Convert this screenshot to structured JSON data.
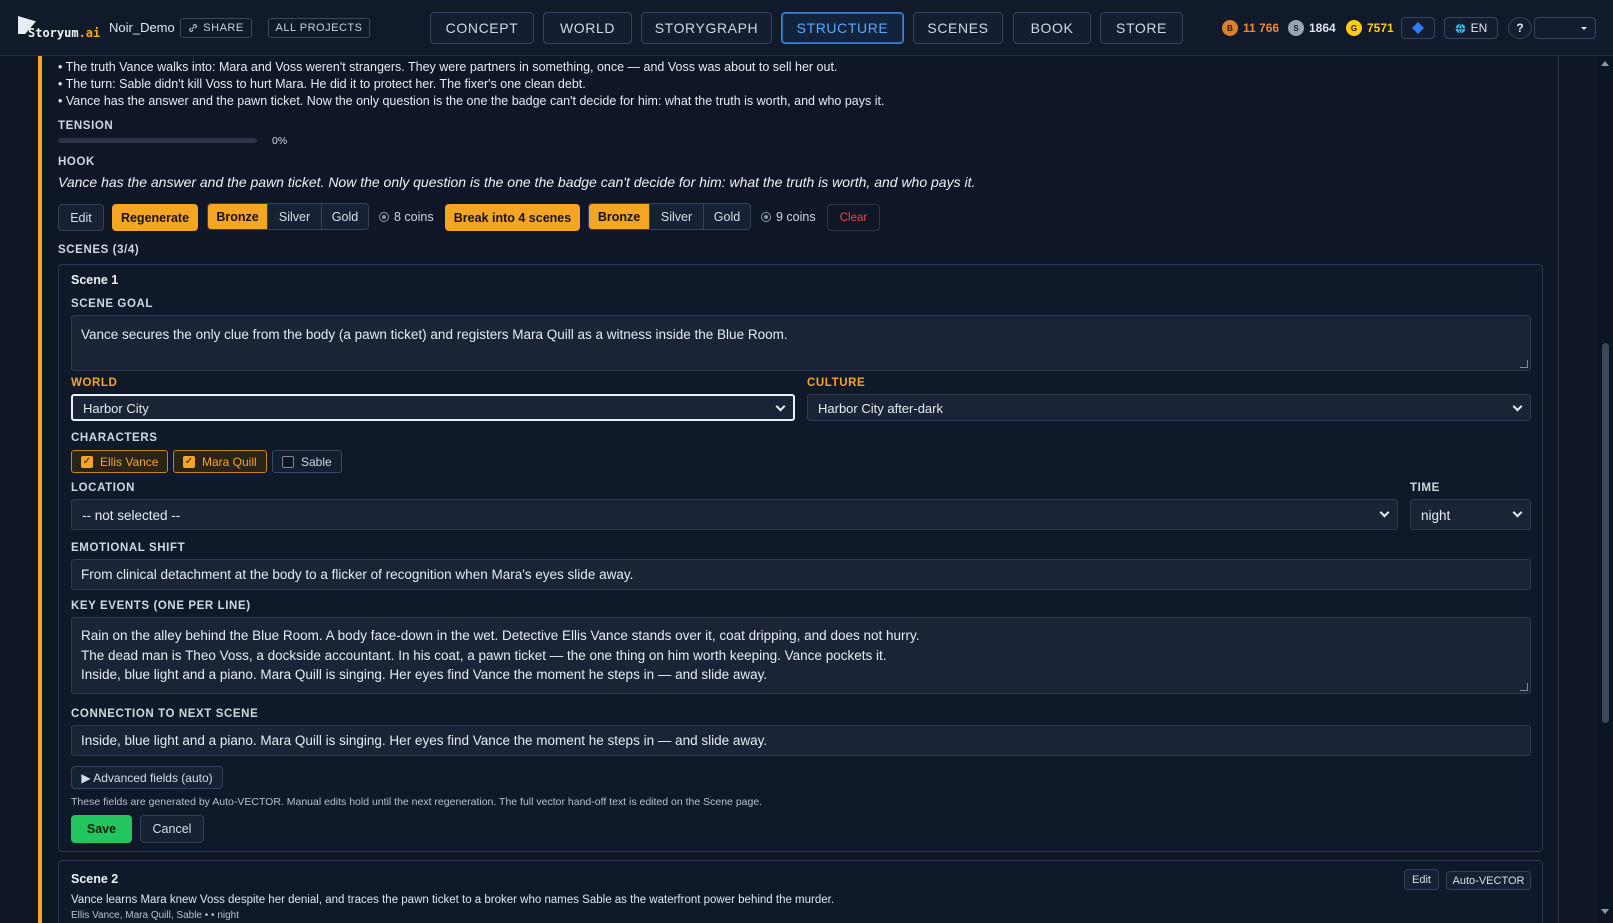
{
  "topbar": {
    "project_name": "Noir_Demo",
    "share_label": "SHARE",
    "all_projects_label": "ALL PROJECTS",
    "tabs": [
      {
        "label": "CONCEPT",
        "active": false
      },
      {
        "label": "WORLD",
        "active": false
      },
      {
        "label": "STORYGRAPH",
        "active": false
      },
      {
        "label": "STRUCTURE",
        "active": true
      },
      {
        "label": "SCENES",
        "active": false
      },
      {
        "label": "BOOK",
        "active": false
      },
      {
        "label": "STORE",
        "active": false
      }
    ],
    "currencies": [
      {
        "letter": "B",
        "value": "11 766",
        "color": "#d9822b"
      },
      {
        "letter": "S",
        "value": "1864",
        "color": "#9aa3b0"
      },
      {
        "letter": "G",
        "value": "7571",
        "color": "#facc15"
      }
    ],
    "diamond_icon": "diamond-icon",
    "language": "EN",
    "help_label": "?",
    "user_menu_value": ""
  },
  "logo": {
    "prefix": "Storyum",
    "suffix": ".ai"
  },
  "summary_bullets": [
    "• The truth Vance walks into: Mara and Voss weren't strangers. They were partners in something, once — and Voss was about to sell her out.",
    "• The turn: Sable didn't kill Voss to hurt Mara. He did it to protect her. The fixer's one clean debt.",
    "• Vance has the answer and the pawn ticket. Now the only question is the one the badge can't decide for him: what the truth is worth, and who pays it."
  ],
  "tension": {
    "label": "TENSION",
    "value_label": "0%",
    "value": 0
  },
  "hook": {
    "label": "HOOK",
    "text": "Vance has the answer and the pawn ticket. Now the only question is the one the badge can't decide for him: what the truth is worth, and who pays it."
  },
  "actions": {
    "edit": "Edit",
    "regenerate": "Regenerate",
    "tiers_1": [
      "Bronze",
      "Silver",
      "Gold"
    ],
    "cost_1": "8 coins",
    "break_into": "Break into 4 scenes",
    "tiers_2": [
      "Bronze",
      "Silver",
      "Gold"
    ],
    "cost_2": "9 coins",
    "clear": "Clear",
    "accent_color": "#f5a524"
  },
  "scenes_header": "SCENES (3/4)",
  "scene1": {
    "title": "Scene 1",
    "goal_label": "SCENE GOAL",
    "goal": "Vance secures the only clue from the body (a pawn ticket) and registers Mara Quill as a witness inside the Blue Room.",
    "world_label": "WORLD",
    "world": "Harbor City",
    "culture_label": "CULTURE",
    "culture": "Harbor City after-dark",
    "characters_label": "CHARACTERS",
    "characters": [
      {
        "name": "Ellis Vance",
        "checked": true
      },
      {
        "name": "Mara Quill",
        "checked": true
      },
      {
        "name": "Sable",
        "checked": false
      }
    ],
    "location_label": "LOCATION",
    "location": "-- not selected --",
    "time_label": "TIME",
    "time": "night",
    "emotional_label": "EMOTIONAL SHIFT",
    "emotional": "From clinical detachment at the body to a flicker of recognition when Mara's eyes slide away.",
    "key_events_label": "KEY EVENTS (ONE PER LINE)",
    "key_events": [
      "Rain on the alley behind the Blue Room. A body face-down in the wet. Detective Ellis Vance stands over it, coat dripping, and does not hurry.",
      "The dead man is Theo Voss, a dockside accountant. In his coat, a pawn ticket — the one thing on him worth keeping. Vance pockets it.",
      "Inside, blue light and a piano. Mara Quill is singing. Her eyes find Vance the moment he steps in — and slide away."
    ],
    "connection_label": "CONNECTION TO NEXT SCENE",
    "connection": "Inside, blue light and a piano. Mara Quill is singing. Her eyes find Vance the moment he steps in — and slide away.",
    "advanced_label": "▶ Advanced fields (auto)",
    "note": "These fields are generated by Auto-VECTOR. Manual edits hold until the next regeneration. The full vector hand-off text is edited on the Scene page.",
    "save": "Save",
    "cancel": "Cancel"
  },
  "scene2": {
    "title": "Scene 2",
    "summary": "Vance learns Mara knew Voss despite her denial, and traces the pawn ticket to a broker who names Sable as the waterfront power behind the murder.",
    "meta": "Ellis Vance, Mara Quill, Sable • • night",
    "edit": "Edit",
    "auto_vector": "Auto-VECTOR"
  }
}
